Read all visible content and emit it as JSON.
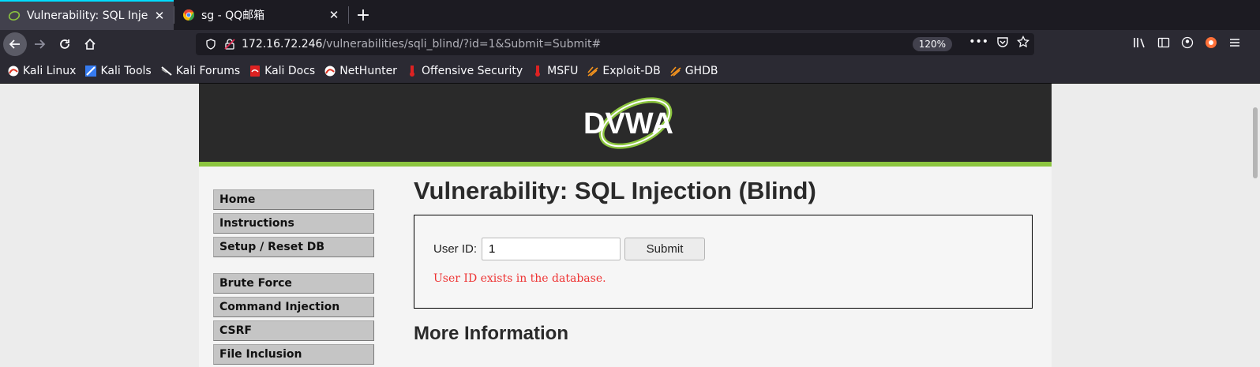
{
  "browser": {
    "tabs": [
      {
        "title": "Vulnerability: SQL Injecti",
        "active": true
      },
      {
        "title": "sg - QQ邮箱",
        "active": false
      }
    ],
    "new_tab_label": "+",
    "url_host": "172.16.72.246",
    "url_path": "/vulnerabilities/sqli_blind/?id=1&Submit=Submit#",
    "zoom": "120%",
    "bookmarks": [
      {
        "label": "Kali Linux",
        "icon": "kali-icon"
      },
      {
        "label": "Kali Tools",
        "icon": "kali-tools-icon"
      },
      {
        "label": "Kali Forums",
        "icon": "kali-forums-icon"
      },
      {
        "label": "Kali Docs",
        "icon": "kali-docs-icon"
      },
      {
        "label": "NetHunter",
        "icon": "nethunter-icon"
      },
      {
        "label": "Offensive Security",
        "icon": "offsec-icon"
      },
      {
        "label": "MSFU",
        "icon": "msfu-icon"
      },
      {
        "label": "Exploit-DB",
        "icon": "exploitdb-icon"
      },
      {
        "label": "GHDB",
        "icon": "ghdb-icon"
      }
    ]
  },
  "dvwa": {
    "logo_text": "DVWA",
    "menu": [
      {
        "label": "Home"
      },
      {
        "label": "Instructions"
      },
      {
        "label": "Setup / Reset DB"
      },
      {
        "label": "Brute Force"
      },
      {
        "label": "Command Injection"
      },
      {
        "label": "CSRF"
      },
      {
        "label": "File Inclusion"
      }
    ],
    "page_title": "Vulnerability: SQL Injection (Blind)",
    "form": {
      "user_id_label": "User ID:",
      "user_id_value": "1",
      "submit_label": "Submit"
    },
    "result_message": "User ID exists in the database.",
    "more_info_heading": "More Information"
  },
  "colors": {
    "accent_green": "#8cc53f",
    "error_red": "#ee3333",
    "header_dark": "#2a2a2a"
  }
}
